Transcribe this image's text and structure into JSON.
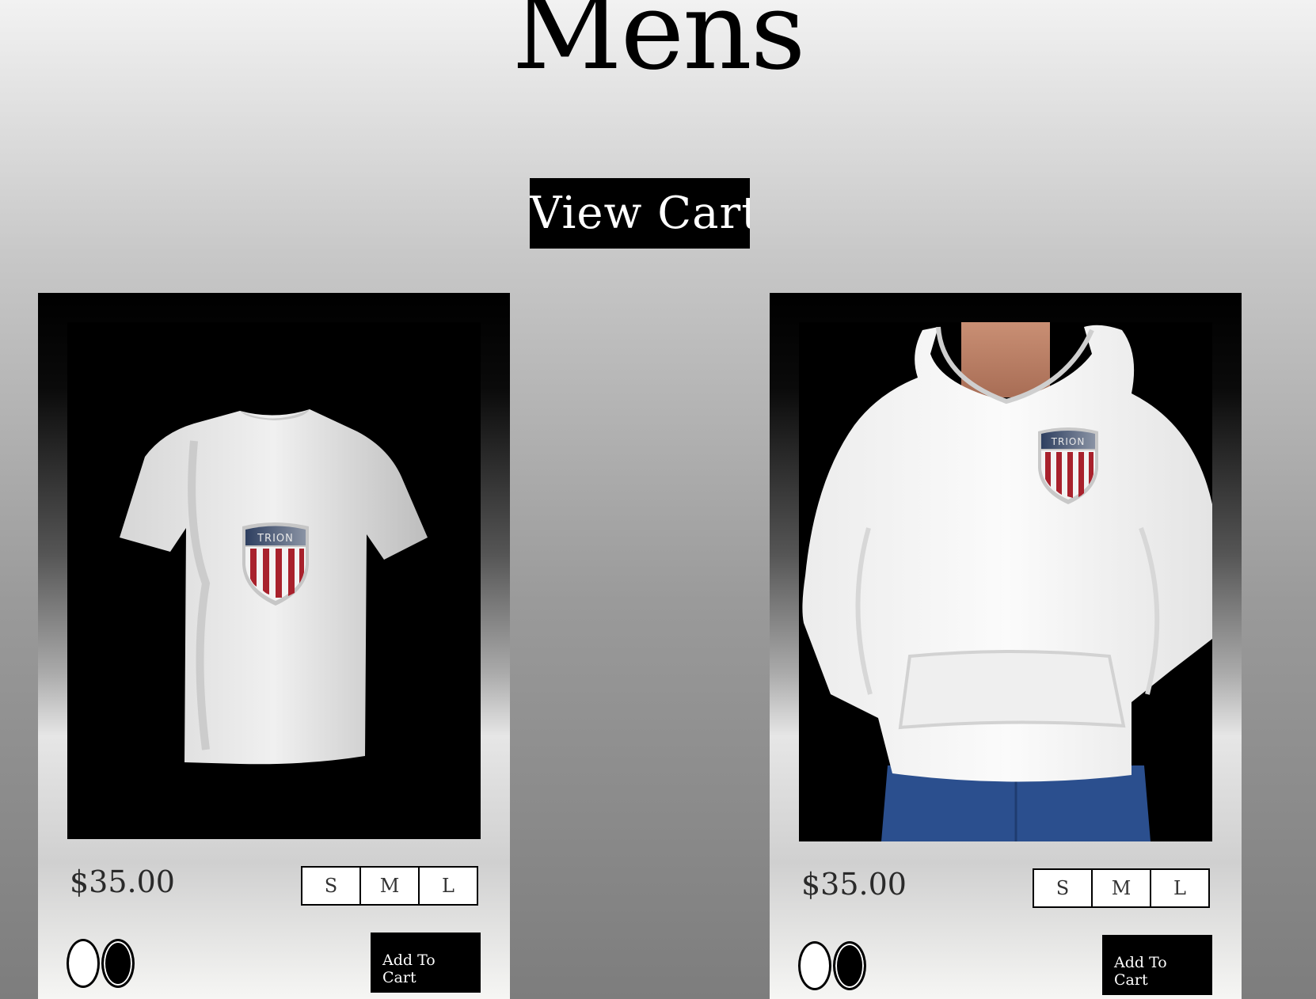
{
  "page": {
    "title": "Mens"
  },
  "header": {
    "view_cart_label": "View Cart"
  },
  "products": [
    {
      "price": "$35.00",
      "sizes": [
        "S",
        "M",
        "L"
      ],
      "colors": [
        "white",
        "black"
      ],
      "add_to_cart_label": "Add To Cart",
      "image_icon": "t-shirt-image",
      "logo_text": "TRION"
    },
    {
      "price": "$35.00",
      "sizes": [
        "S",
        "M",
        "L"
      ],
      "colors": [
        "white",
        "black"
      ],
      "add_to_cart_label": "Add To Cart",
      "image_icon": "hoodie-image",
      "logo_text": "TRION"
    }
  ],
  "colors": {
    "background_top": "#f2f2f2",
    "background_bottom": "#7d7d7d",
    "card": "#000000",
    "accent_red": "#b0222c",
    "accent_blue": "#3a4a66"
  }
}
